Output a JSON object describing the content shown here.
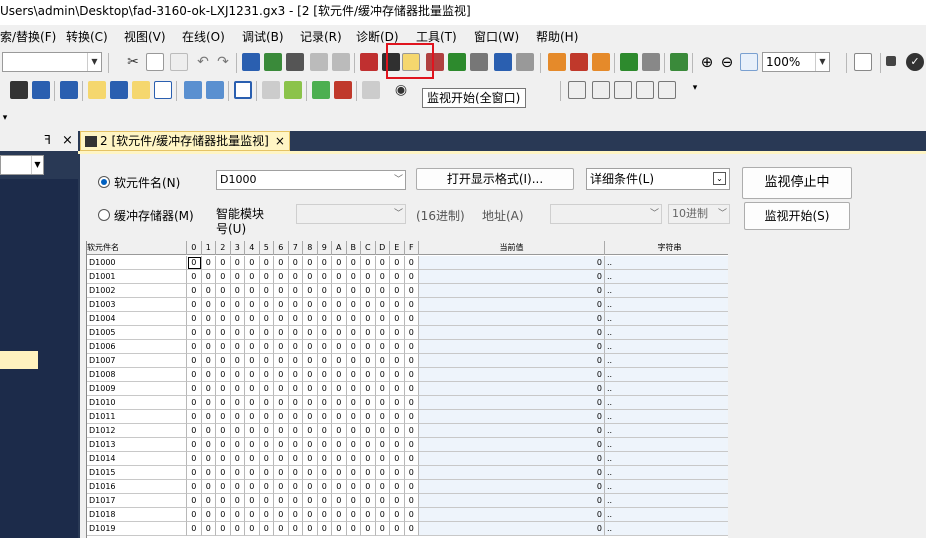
{
  "title": "Users\\admin\\Desktop\\fad-3160-ok-LXJ1231.gx3 - [2 [软元件/缓冲存储器批量监视]",
  "menu": [
    "索/替换(F)",
    "转换(C)",
    "视图(V)",
    "在线(O)",
    "调试(B)",
    "记录(R)",
    "诊断(D)",
    "工具(T)",
    "窗口(W)",
    "帮助(H)"
  ],
  "toolbar": {
    "zoom": "100%",
    "tooltip": "监视开始(全窗口)"
  },
  "tab": {
    "label": "2 [软元件/缓冲存储器批量监视]",
    "close": "×"
  },
  "form": {
    "device_label": "软元件名(N)",
    "device_value": "D1000",
    "buffer_label": "缓冲存储器(M)",
    "module_label_1": "智能模块",
    "module_label_2": "号(U)",
    "hex_label": "(16进制)",
    "address_label": "地址(A)",
    "dec_value": "10进制",
    "open_format": "打开显示格式(I)...",
    "detail": "详细条件(L)",
    "monitor_stop": "监视停止中",
    "monitor_start": "监视开始(S)"
  },
  "grid": {
    "headers": {
      "name": "软元件名",
      "current": "当前值",
      "string": "字符串"
    },
    "bits": [
      "0",
      "1",
      "2",
      "3",
      "4",
      "5",
      "6",
      "7",
      "8",
      "9",
      "A",
      "B",
      "C",
      "D",
      "E",
      "F"
    ],
    "rows": [
      {
        "name": "D1000",
        "cur": "0",
        "str": ".."
      },
      {
        "name": "D1001",
        "cur": "0",
        "str": ".."
      },
      {
        "name": "D1002",
        "cur": "0",
        "str": ".."
      },
      {
        "name": "D1003",
        "cur": "0",
        "str": ".."
      },
      {
        "name": "D1004",
        "cur": "0",
        "str": ".."
      },
      {
        "name": "D1005",
        "cur": "0",
        "str": ".."
      },
      {
        "name": "D1006",
        "cur": "0",
        "str": ".."
      },
      {
        "name": "D1007",
        "cur": "0",
        "str": ".."
      },
      {
        "name": "D1008",
        "cur": "0",
        "str": ".."
      },
      {
        "name": "D1009",
        "cur": "0",
        "str": ".."
      },
      {
        "name": "D1010",
        "cur": "0",
        "str": ".."
      },
      {
        "name": "D1011",
        "cur": "0",
        "str": ".."
      },
      {
        "name": "D1012",
        "cur": "0",
        "str": ".."
      },
      {
        "name": "D1013",
        "cur": "0",
        "str": ".."
      },
      {
        "name": "D1014",
        "cur": "0",
        "str": ".."
      },
      {
        "name": "D1015",
        "cur": "0",
        "str": ".."
      },
      {
        "name": "D1016",
        "cur": "0",
        "str": ".."
      },
      {
        "name": "D1017",
        "cur": "0",
        "str": ".."
      },
      {
        "name": "D1018",
        "cur": "0",
        "str": ".."
      },
      {
        "name": "D1019",
        "cur": "0",
        "str": ".."
      }
    ],
    "bit_value": "0"
  },
  "leftpane": {
    "pin": "ꟻ",
    "close": "×"
  }
}
